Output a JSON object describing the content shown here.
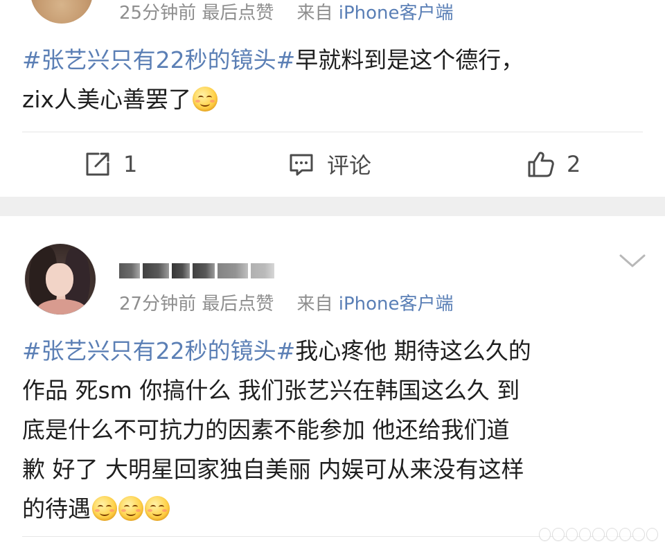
{
  "posts": [
    {
      "time": "25分钟前",
      "last_like": "最后点赞",
      "source_prefix": "来自",
      "source": "iPhone客户端",
      "topic": "#张艺兴只有22秒的镜头#",
      "line1_rest": "早就料到是这个德行，",
      "line2": "zix人美心善罢了",
      "emojis": 1,
      "actions": {
        "repost_count": "1",
        "comment_label": "评论",
        "like_count": "2"
      }
    },
    {
      "time": "27分钟前",
      "last_like": "最后点赞",
      "source_prefix": "来自",
      "source": "iPhone客户端",
      "topic": "#张艺兴只有22秒的镜头#",
      "line1_rest": "我心疼他  期待这么久的",
      "line2": "作品  死sm 你搞什么  我们张艺兴在韩国这么久  到",
      "line3": "底是什么不可抗力的因素不能参加  他还给我们道",
      "line4": "歉  好了 大明星回家独自美丽  内娱可从来没有这样",
      "line5": "的待遇",
      "emojis": 3
    }
  ],
  "colors": {
    "link": "#5b7fb5",
    "meta": "#8e8e8e",
    "separator": "#efefef"
  }
}
